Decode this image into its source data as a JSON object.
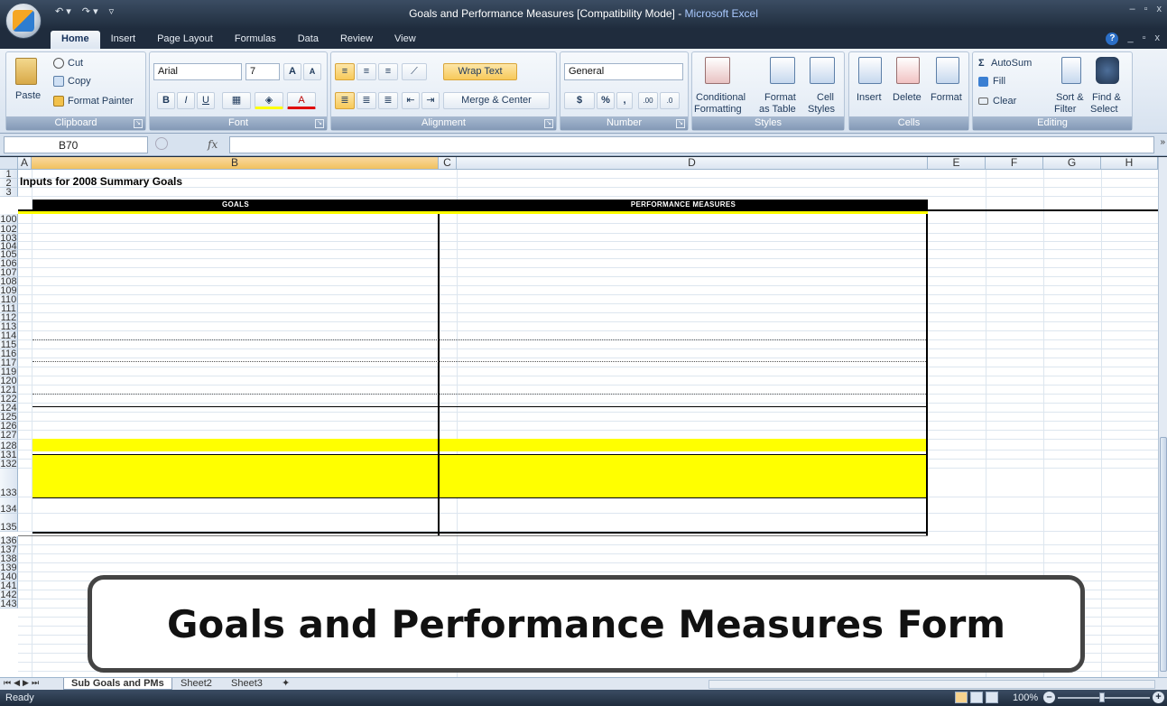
{
  "window": {
    "title": "Goals and Performance Measures  [Compatibility Mode]",
    "title_sep": " - ",
    "app_name": "Microsoft Excel",
    "qat_undo": "↶ ▾",
    "qat_redo": "↷ ▾",
    "qat_more": "▿",
    "min": "–",
    "restore": "▫",
    "close": "x"
  },
  "ribbon_tabs": [
    "Home",
    "Insert",
    "Page Layout",
    "Formulas",
    "Data",
    "Review",
    "View"
  ],
  "tab_right": {
    "help": "?",
    "min": "_",
    "restore": "▫",
    "close": "x"
  },
  "clipboard": {
    "paste": "Paste",
    "cut": "Cut",
    "copy": "Copy",
    "format_painter": "Format Painter",
    "label": "Clipboard"
  },
  "font": {
    "name": "Arial",
    "size": "7",
    "grow": "A",
    "shrink": "A",
    "bold": "B",
    "italic": "I",
    "underline": "U",
    "label": "Font"
  },
  "alignment": {
    "wrap_text": "Wrap Text",
    "merge_center": "Merge & Center",
    "label": "Alignment"
  },
  "number": {
    "format": "General",
    "currency": "$",
    "percent": "%",
    "comma": ",",
    "label": "Number"
  },
  "styles": {
    "conditional": "Conditional",
    "conditional2": "Formatting",
    "format_as": "Format",
    "format_as2": "as Table",
    "cell": "Cell",
    "cell2": "Styles",
    "label": "Styles"
  },
  "cells": {
    "insert": "Insert",
    "delete": "Delete",
    "format": "Format",
    "label": "Cells"
  },
  "editing": {
    "autosum": "AutoSum",
    "fill": "Fill",
    "clear": "Clear",
    "sort": "Sort &",
    "sort2": "Filter",
    "find": "Find &",
    "find2": "Select",
    "label": "Editing",
    "sigma": "Σ"
  },
  "formula_bar": {
    "name_box": "B70",
    "fx": "fx",
    "value": ""
  },
  "columns": [
    "A",
    "B",
    "C",
    "D",
    "E",
    "F",
    "G",
    "H"
  ],
  "cells_content": {
    "a1": "Inputs for 2008 Summary Goals",
    "goals_header": "GOALS",
    "pm_header": "PERFORMANCE MEASURES"
  },
  "rows": [
    "1",
    "2",
    "3",
    "100",
    "102",
    "103",
    "104",
    "105",
    "106",
    "107",
    "108",
    "109",
    "110",
    "111",
    "112",
    "113",
    "114",
    "115",
    "116",
    "117",
    "119",
    "120",
    "121",
    "122",
    "124",
    "125",
    "126",
    "127",
    "128",
    "131",
    "132",
    "133",
    "134",
    "135",
    "136",
    "137",
    "138",
    "139",
    "140",
    "141",
    "142",
    "143"
  ],
  "sheet_tabs": [
    "Sub Goals and PMs",
    "Sheet2",
    "Sheet3"
  ],
  "status": {
    "ready": "Ready",
    "zoom": "100%",
    "zoom_minus": "–",
    "zoom_plus": "+"
  },
  "caption": "Goals and Performance Measures Form"
}
